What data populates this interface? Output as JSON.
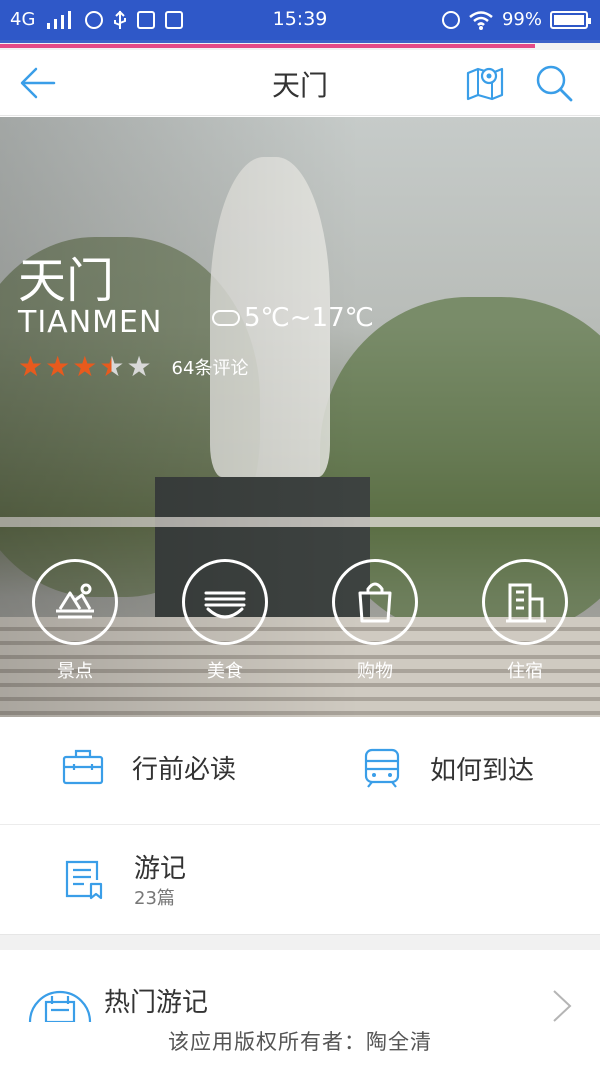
{
  "status_bar": {
    "network": "4G",
    "time": "15:39",
    "battery": "99%"
  },
  "header": {
    "title": "天门"
  },
  "city": {
    "name_cn": "天门",
    "name_en": "TIANMEN",
    "weather": "5℃~17℃",
    "rating": 3.5,
    "rating_max": 5,
    "reviews": "64条评论"
  },
  "categories": [
    {
      "label": "景点",
      "icon": "scenic-icon"
    },
    {
      "label": "美食",
      "icon": "food-bowl-icon"
    },
    {
      "label": "购物",
      "icon": "shopping-bag-icon"
    },
    {
      "label": "住宿",
      "icon": "hotel-icon"
    }
  ],
  "links": {
    "guide": "行前必读",
    "transport": "如何到达",
    "travelogue": "游记",
    "travelogue_count": "23篇"
  },
  "hot_section": {
    "title": "热门游记"
  },
  "footer": {
    "text": "该应用版权所有者：陶全清"
  },
  "colors": {
    "status_bar": "#2f58c8",
    "accent_blue": "#3a9ee8",
    "star_orange": "#e85a1d",
    "progress_pink": "#e54a86"
  }
}
